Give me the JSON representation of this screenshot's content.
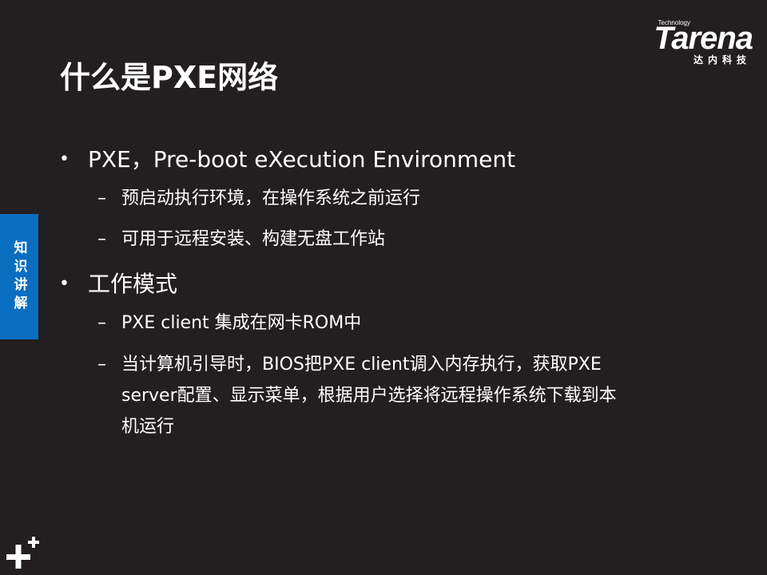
{
  "logo": {
    "tagline": "Technology",
    "wordmark": "Tarena",
    "chinese": "达内科技"
  },
  "title": "什么是PXE网络",
  "bullets": [
    {
      "bullet": "•",
      "text": "PXE，Pre-boot eXecution Environment",
      "subs": [
        {
          "dash": "–",
          "text": "预启动执行环境，在操作系统之前运行"
        },
        {
          "dash": "–",
          "text": "可用于远程安装、构建无盘工作站"
        }
      ]
    },
    {
      "bullet": "•",
      "text": "工作模式",
      "subs": [
        {
          "dash": "–",
          "text": "PXE client 集成在网卡ROM中"
        },
        {
          "dash": "–",
          "text": "当计算机引导时，BIOS把PXE client调入内存执行，获取PXE server配置、显示菜单，根据用户选择将远程操作系统下载到本机运行"
        }
      ]
    }
  ],
  "side_tab": {
    "label": "知识讲解"
  },
  "decor": {
    "plus_icon": "plus-plus-icon",
    "accent_color": "#0a6ec0",
    "background_color": "#231f20"
  }
}
